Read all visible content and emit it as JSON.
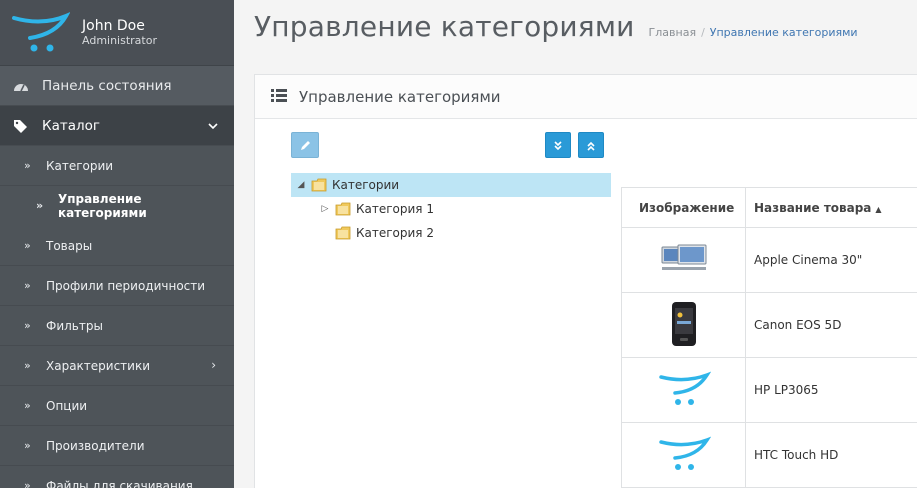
{
  "profile": {
    "name": "John Doe",
    "role": "Administrator"
  },
  "nav": {
    "dashboard": "Панель состояния",
    "catalog": "Каталог",
    "catalog_items": [
      {
        "label": "Категории",
        "active": false,
        "has_submenu": false
      },
      {
        "label": "Управление категориями",
        "active": true,
        "has_submenu": false
      },
      {
        "label": "Товары",
        "active": false,
        "has_submenu": false
      },
      {
        "label": "Профили периодичности",
        "active": false,
        "has_submenu": false
      },
      {
        "label": "Фильтры",
        "active": false,
        "has_submenu": false
      },
      {
        "label": "Характеристики",
        "active": false,
        "has_submenu": true
      },
      {
        "label": "Опции",
        "active": false,
        "has_submenu": false
      },
      {
        "label": "Производители",
        "active": false,
        "has_submenu": false
      },
      {
        "label": "Файлы для скачивания",
        "active": false,
        "has_submenu": false
      }
    ]
  },
  "header": {
    "title": "Управление категориями",
    "breadcrumb": [
      "Главная",
      "Управление категориями"
    ]
  },
  "panel": {
    "title": "Управление категориями"
  },
  "tree": {
    "root": "Категории",
    "children": [
      "Категория 1",
      "Категория 2"
    ]
  },
  "table": {
    "columns": [
      "Изображение",
      "Название товара"
    ],
    "rows": [
      {
        "image": "monitor-icon",
        "name": "Apple Cinema 30\""
      },
      {
        "image": "phone-icon",
        "name": "Canon EOS 5D"
      },
      {
        "image": "cart-logo-icon",
        "name": "HP LP3065"
      },
      {
        "image": "cart-logo-icon",
        "name": "HTC Touch HD"
      }
    ]
  },
  "colors": {
    "sidebar": "#555b61",
    "accent": "#2a9ad7",
    "tree_selected": "#bde5f5",
    "link": "#3f76b1"
  }
}
